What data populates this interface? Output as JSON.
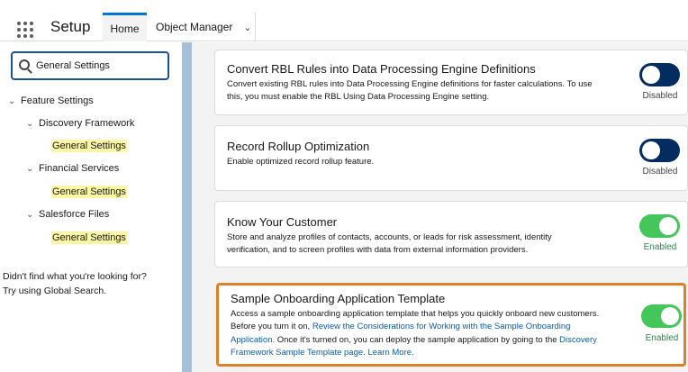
{
  "header": {
    "app_title": "Setup",
    "tabs": [
      {
        "label": "Home"
      },
      {
        "label": "Object Manager"
      }
    ]
  },
  "sidebar": {
    "search_value": "General Settings",
    "tree": [
      {
        "label": "Feature Settings"
      },
      {
        "label": "Discovery Framework",
        "child": "General Settings"
      },
      {
        "label": "Financial Services",
        "child": "General Settings"
      },
      {
        "label": "Salesforce Files",
        "child": "General Settings"
      }
    ],
    "help_line1": "Didn't find what you're looking for?",
    "help_line2": "Try using Global Search."
  },
  "cards": [
    {
      "title": "Convert RBL Rules into Data Processing Engine Definitions",
      "desc_1": "Convert existing RBL rules into Data Processing Engine definitions for faster calculations. To use",
      "desc_2": "this, you must enable the RBL Using Data Processing Engine setting.",
      "status": "Disabled"
    },
    {
      "title": "Record Rollup Optimization",
      "desc_1": "Enable optimized record rollup feature.",
      "status": "Disabled"
    },
    {
      "title": "Know Your Customer",
      "desc_1": "Store and analyze profiles of contacts, accounts, or leads for risk assessment, identity",
      "desc_2": "verification, and to screen profiles with data from external information providers.",
      "status": "Enabled"
    },
    {
      "title": "Sample Onboarding Application Template",
      "line1": "Access a sample onboarding application template that helps you quickly onboard new customers.",
      "line2_pre": "Before you turn it on, ",
      "line2_link": "Review the Considerations for Working with the Sample Onboarding",
      "line3_link": "Application.",
      "line3_post": " Once it's turned on, you can deploy the sample application by going to the ",
      "line3_link2": "Discovery",
      "line4_link": "Framework Sample Template page.",
      "line4_space": " ",
      "line4_link2": "Learn More.",
      "status": "Enabled"
    }
  ],
  "colors": {
    "brand": "#0176d3",
    "toggle_off": "#032d60",
    "toggle_on": "#45c65a",
    "highlight_border": "#d9822b",
    "match_highlight": "#fbf6a5"
  },
  "icons": [
    "app-launcher-icon",
    "chevron-down-icon",
    "search-icon",
    "chevron-right-icon"
  ]
}
